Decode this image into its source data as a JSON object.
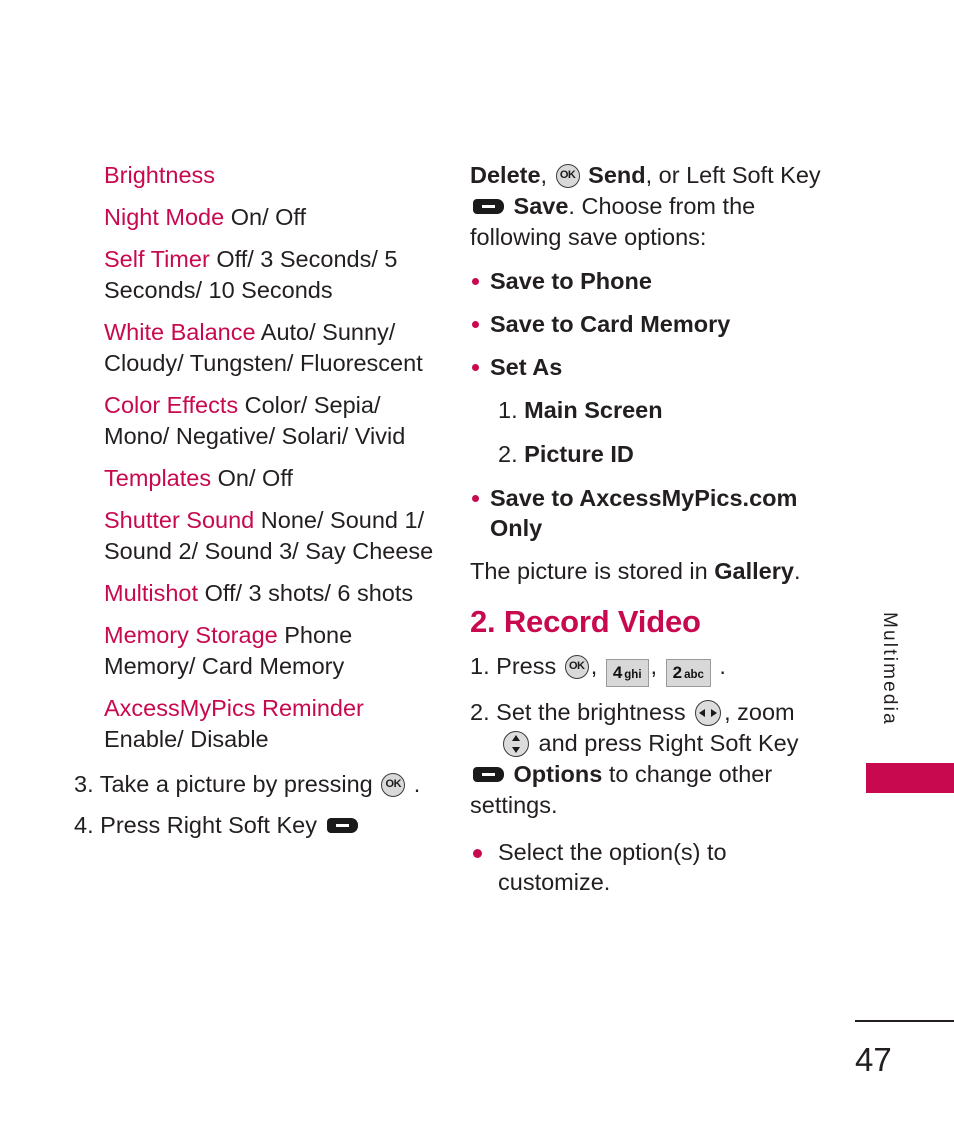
{
  "page": {
    "number": "47",
    "chapter_tab": "Multimedia",
    "accent_color": "#c8094f",
    "text_color": "#231f20"
  },
  "icons": {
    "ok": "ok-key-icon",
    "soft_key": "soft-key-icon",
    "nav_left_right": "nav-left-right-icon",
    "nav_up_down": "nav-up-down-icon",
    "key_4": {
      "digit": "4",
      "letters": "ghi"
    },
    "key_2": {
      "digit": "2",
      "letters": "abc"
    }
  },
  "left_column": {
    "settings": [
      {
        "name": "Brightness",
        "values": ""
      },
      {
        "name": "Night Mode",
        "values": "On/ Off"
      },
      {
        "name": "Self Timer",
        "values": "Off/ 3 Seconds/ 5 Seconds/ 10 Seconds"
      },
      {
        "name": "White Balance",
        "values": "Auto/ Sunny/ Cloudy/ Tungsten/ Fluorescent"
      },
      {
        "name": "Color Effects",
        "values": "Color/ Sepia/ Mono/ Negative/ Solari/ Vivid"
      },
      {
        "name": "Templates",
        "values": "On/ Off"
      },
      {
        "name": "Shutter Sound",
        "values": "None/ Sound 1/ Sound 2/ Sound 3/ Say Cheese"
      },
      {
        "name": "Multishot",
        "values": "Off/ 3 shots/ 6 shots"
      },
      {
        "name": "Memory Storage",
        "values": "Phone Memory/ Card Memory"
      },
      {
        "name": "AxcessMyPics Reminder",
        "values": "Enable/ Disable"
      }
    ],
    "steps": [
      {
        "num": "3.",
        "before": "Take a picture by pressing",
        "after": "."
      },
      {
        "num": "4.",
        "before": "Press Right Soft Key",
        "after": ""
      }
    ]
  },
  "right_column": {
    "intro": {
      "p1_a": "Delete",
      "p1_b": ",",
      "p1_c": "Send",
      "p1_d": ", or Left Soft Key",
      "p1_e": "Save",
      "p1_f": ". Choose from the following save options:"
    },
    "save_options": [
      "Save to Phone",
      "Save to Card Memory",
      "Set As"
    ],
    "set_as_items": [
      {
        "num": "1.",
        "label": "Main Screen"
      },
      {
        "num": "2.",
        "label": "Picture ID"
      }
    ],
    "save_options_2": [
      "Save to AxcessMyPics.com Only"
    ],
    "stored_note": {
      "before": "The picture is stored in",
      "bold": "Gallery",
      "after": "."
    },
    "section_heading": "2. Record Video",
    "steps": [
      {
        "num": "1.",
        "a": "Press",
        "b": ",",
        "c": ",",
        "d": "."
      },
      {
        "num": "2.",
        "a": "Set the brightness",
        "b": ", zoom",
        "c": "and press Right Soft Key",
        "d": "Options",
        "e": "to change other settings."
      }
    ],
    "final_bullet": "Select the option(s) to customize."
  }
}
